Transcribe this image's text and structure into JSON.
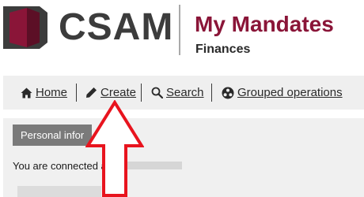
{
  "header": {
    "logo_text": "CSAM",
    "app_title": "My Mandates",
    "app_subtitle": "Finances"
  },
  "nav": {
    "items": [
      {
        "label": "Home",
        "icon": "home-icon"
      },
      {
        "label": "Create",
        "icon": "pencil-icon"
      },
      {
        "label": "Search",
        "icon": "search-icon"
      },
      {
        "label": "Grouped operations",
        "icon": "grouped-operations-icon"
      }
    ]
  },
  "panel": {
    "tab_label": "Personal infor",
    "connected_text": "You are connected a"
  },
  "colors": {
    "brand": "#8a1538",
    "logo_gray": "#3c3c3c",
    "nav_bg": "#efefef",
    "tab_bg": "#7a7a7a",
    "arrow": "#e8141e"
  }
}
